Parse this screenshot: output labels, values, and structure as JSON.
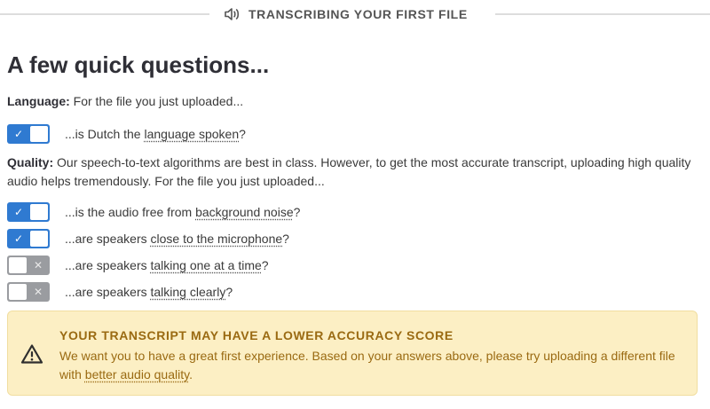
{
  "header": {
    "title": "TRANSCRIBING YOUR FIRST FILE",
    "icon": "speaker-icon"
  },
  "page": {
    "heading": "A few quick questions..."
  },
  "language": {
    "label": "Language:",
    "text": "For the file you just uploaded...",
    "question": {
      "prefix": "...is Dutch the ",
      "term": "language spoken",
      "suffix": "?",
      "checked": true
    }
  },
  "quality": {
    "label": "Quality:",
    "text": "Our speech-to-text algorithms are best in class. However, to get the most accurate transcript, uploading high quality audio helps tremendously. For the file you just uploaded...",
    "questions": [
      {
        "prefix": "...is the audio free from ",
        "term": "background noise",
        "suffix": "?",
        "checked": true
      },
      {
        "prefix": "...are speakers ",
        "term": "close to the microphone",
        "suffix": "?",
        "checked": true
      },
      {
        "prefix": "...are speakers ",
        "term": "talking one at a time",
        "suffix": "?",
        "checked": false
      },
      {
        "prefix": "...are speakers ",
        "term": "talking clearly",
        "suffix": "?",
        "checked": false
      }
    ]
  },
  "toggle": {
    "on_symbol": "✓",
    "off_symbol": "✕",
    "on_color": "#2f7ad1",
    "off_color": "#9a9ca0"
  },
  "alert": {
    "title": "YOUR TRANSCRIPT MAY HAVE A LOWER ACCURACY SCORE",
    "body_prefix": "We want you to have a great first experience. Based on your answers above, please try uploading a different file with ",
    "link": "better audio quality",
    "body_suffix": ".",
    "icon": "warning-icon",
    "background": "#fcefc4",
    "text_color": "#9a6a12"
  }
}
